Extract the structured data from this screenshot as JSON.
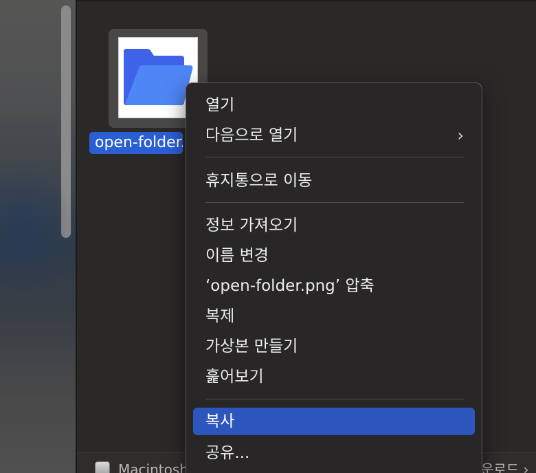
{
  "file": {
    "name": "open-folder.png",
    "icon": "folder-icon",
    "folder_back_color": "#3f63e8",
    "folder_front_color": "#4f86f5"
  },
  "path_bar": {
    "disk_label": "Macintosh",
    "right_label": "운로드 ›"
  },
  "context_menu": {
    "items": [
      {
        "label": "열기"
      },
      {
        "label": "다음으로 열기",
        "submenu_glyph": "›"
      },
      {
        "label": "휴지통으로 이동"
      },
      {
        "label": "정보 가져오기"
      },
      {
        "label": "이름 변경"
      },
      {
        "label": "‘open-folder.png’ 압축"
      },
      {
        "label": "복제"
      },
      {
        "label": "가상본 만들기"
      },
      {
        "label": "훑어보기"
      },
      {
        "label": "복사",
        "highlighted": true
      },
      {
        "label": "공유..."
      }
    ]
  },
  "colors": {
    "selection_blue": "#2a5fd4",
    "menu_highlight": "#2c55bd",
    "menu_background": "#282626"
  }
}
